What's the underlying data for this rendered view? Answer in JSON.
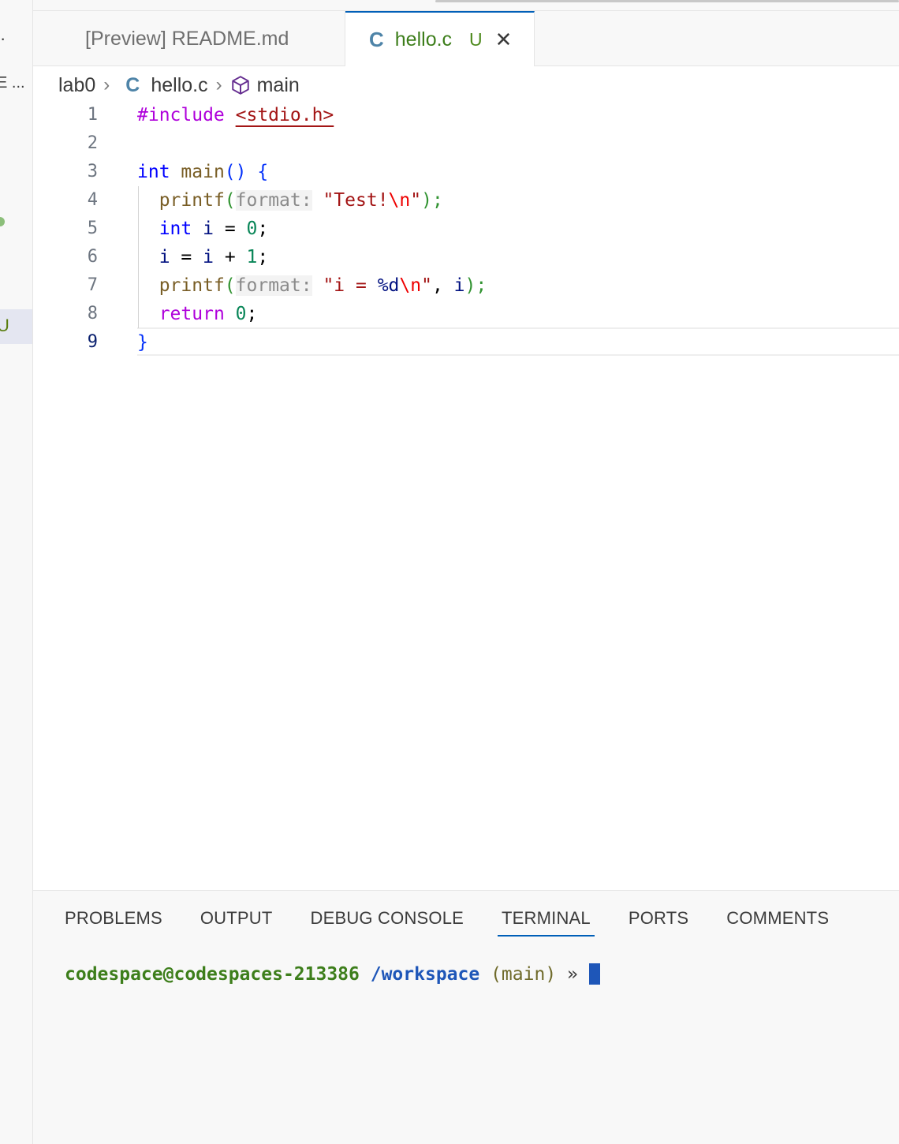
{
  "sidebar": {
    "frag_top": "·",
    "frag_more": "E ...",
    "frag_u": "U"
  },
  "tabs": [
    {
      "label": "[Preview] README.md"
    },
    {
      "icon": "C",
      "label": "hello.c",
      "status": "U",
      "close": "✕"
    }
  ],
  "breadcrumb": {
    "folder": "lab0",
    "file_icon": "C",
    "file": "hello.c",
    "symbol": "main"
  },
  "editor": {
    "line_numbers": [
      "1",
      "2",
      "3",
      "4",
      "5",
      "6",
      "7",
      "8",
      "9"
    ],
    "lines": [
      [
        "#include",
        " ",
        "<stdio.h>"
      ],
      [],
      [
        "int",
        " ",
        "main",
        "()",
        " ",
        "{"
      ],
      [
        "  ",
        "printf",
        "(",
        "format:",
        " ",
        "\"Test!",
        "\\n",
        "\"",
        ");"
      ],
      [
        "  ",
        "int",
        " ",
        "i",
        " = ",
        "0",
        ";"
      ],
      [
        "  ",
        "i",
        " = ",
        "i",
        " + ",
        "1",
        ";"
      ],
      [
        "  ",
        "printf",
        "(",
        "format:",
        " ",
        "\"i = ",
        "%d",
        "\\n",
        "\"",
        ", ",
        "i",
        ");"
      ],
      [
        "  ",
        "return",
        " ",
        "0",
        ";"
      ],
      [
        "}"
      ]
    ]
  },
  "panel": {
    "tabs": [
      "PROBLEMS",
      "OUTPUT",
      "DEBUG CONSOLE",
      "TERMINAL",
      "PORTS",
      "COMMENTS"
    ],
    "active_tab": "TERMINAL",
    "prompt_user": "codespace@codespaces-213386",
    "prompt_path": "/workspace",
    "prompt_branch": "(main)",
    "prompt_arrow": "»"
  }
}
